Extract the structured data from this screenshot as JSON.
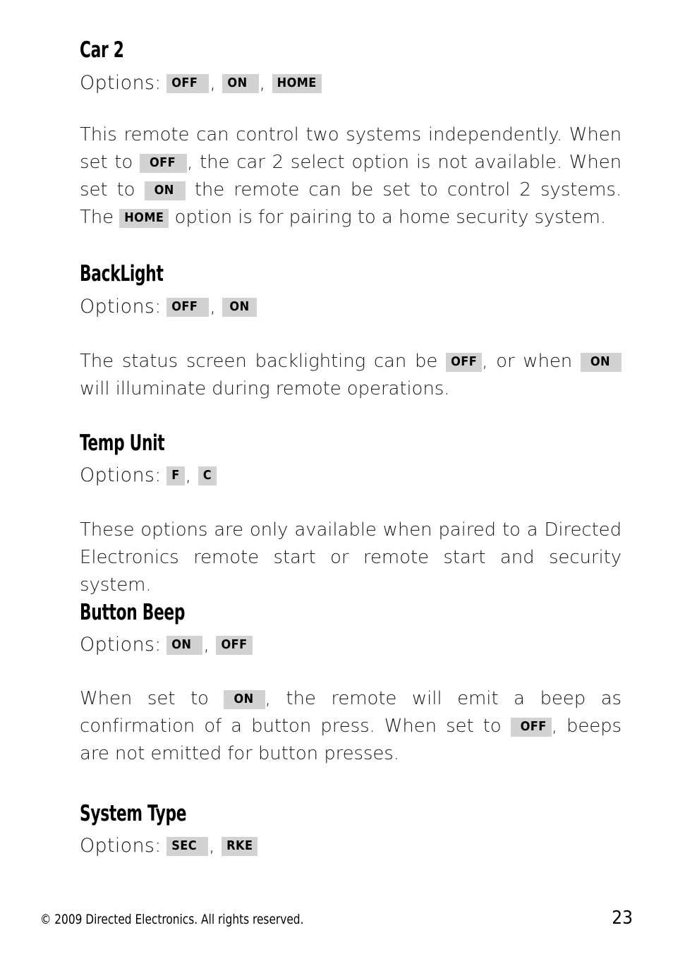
{
  "page": {
    "number": "23",
    "copyright": "© 2009 Directed Electronics. All rights reserved.",
    "options_label": "Options:",
    "comma": ","
  },
  "sections": [
    {
      "id": "car-2",
      "heading": "Car 2",
      "options": [
        "OFF",
        "ON",
        "HOME"
      ],
      "body_parts": [
        {
          "type": "text",
          "value": "This remote can control two systems independently. When set to "
        },
        {
          "type": "badge",
          "value": "OFF"
        },
        {
          "type": "text",
          "value": ", the car 2 select option is not available. When set to "
        },
        {
          "type": "badge",
          "value": "ON"
        },
        {
          "type": "text",
          "value": " the remote can be set to control 2 systems. The "
        },
        {
          "type": "badge",
          "value": "HOME"
        },
        {
          "type": "text",
          "value": " option is for pairing to a home security system."
        }
      ]
    },
    {
      "id": "backlight",
      "heading": "BackLight",
      "options": [
        "OFF",
        "ON"
      ],
      "body_parts": [
        {
          "type": "text",
          "value": "The status screen backlighting can be "
        },
        {
          "type": "badge",
          "value": "OFF"
        },
        {
          "type": "text",
          "value": ", or when "
        },
        {
          "type": "badge",
          "value": "ON"
        },
        {
          "type": "text",
          "value": " will illuminate  during remote operations."
        }
      ]
    },
    {
      "id": "temp-unit",
      "heading": "Temp Unit",
      "options": [
        "F",
        "C"
      ],
      "body_parts": [
        {
          "type": "text",
          "value": "These options are only available when paired to a Directed Electronics remote start or remote start and security system."
        }
      ]
    },
    {
      "id": "button-beep",
      "heading": "Button Beep",
      "options": [
        "ON",
        "OFF"
      ],
      "body_parts": [
        {
          "type": "text",
          "value": "When set to "
        },
        {
          "type": "badge",
          "value": "ON"
        },
        {
          "type": "text",
          "value": ", the remote will emit a beep as confirmation of a button press. When set to "
        },
        {
          "type": "badge",
          "value": "OFF"
        },
        {
          "type": "text",
          "value": ", beeps are not emitted for button presses."
        }
      ]
    },
    {
      "id": "system-type",
      "heading": "System Type",
      "options": [
        "SEC",
        "RKE"
      ],
      "body_parts": []
    }
  ]
}
